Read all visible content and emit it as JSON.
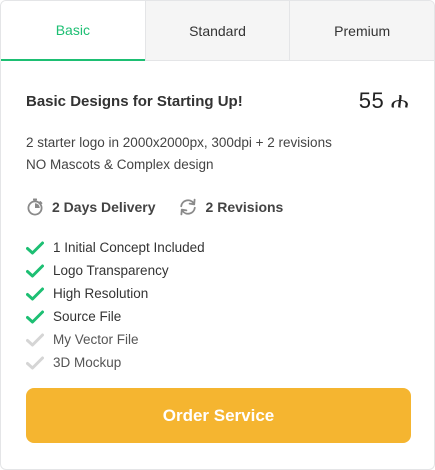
{
  "tabs": [
    {
      "label": "Basic",
      "active": true
    },
    {
      "label": "Standard",
      "active": false
    },
    {
      "label": "Premium",
      "active": false
    }
  ],
  "package": {
    "title": "Basic Designs for Starting Up!",
    "price": "55 ሐ",
    "description_lines": [
      "2 starter logo in 2000x2000px, 300dpi + 2 revisions",
      "NO Mascots & Complex design"
    ],
    "delivery": {
      "icon": "stopwatch-icon",
      "label": "2 Days Delivery"
    },
    "revisions": {
      "icon": "refresh-icon",
      "label": "2 Revisions"
    }
  },
  "features": [
    {
      "label": "1 Initial Concept Included",
      "included": true
    },
    {
      "label": "Logo Transparency",
      "included": true
    },
    {
      "label": "High Resolution",
      "included": true
    },
    {
      "label": "Source File",
      "included": true
    },
    {
      "label": "My Vector File",
      "included": false
    },
    {
      "label": "3D Mockup",
      "included": false
    }
  ],
  "order_button": {
    "label": "Order Service"
  },
  "colors": {
    "accent_green": "#1dbf73",
    "check_muted": "#d5d5d5",
    "order_button": "#f5b530"
  }
}
